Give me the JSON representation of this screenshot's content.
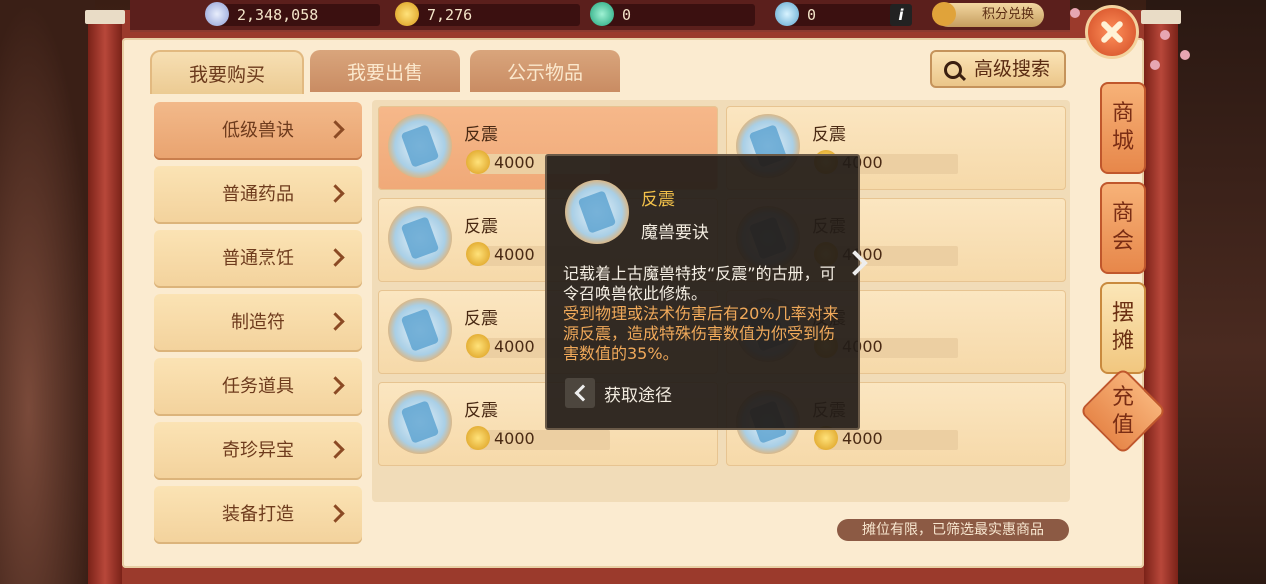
{
  "currencies": [
    {
      "icon": "silver-coin-icon",
      "value": "2,348,058"
    },
    {
      "icon": "gold-coin-icon",
      "value": "7,276"
    },
    {
      "icon": "jade-icon",
      "value": "0"
    },
    {
      "icon": "gem-icon",
      "value": "0"
    }
  ],
  "info_label": "i",
  "exchange_label": "积分兑换",
  "tabs": [
    {
      "label": "我要购买",
      "active": true
    },
    {
      "label": "我要出售",
      "active": false
    },
    {
      "label": "公示物品",
      "active": false
    }
  ],
  "search_label": "高级搜索",
  "categories": [
    {
      "label": "低级兽诀",
      "active": true
    },
    {
      "label": "普通药品",
      "active": false
    },
    {
      "label": "普通烹饪",
      "active": false
    },
    {
      "label": "制造符",
      "active": false
    },
    {
      "label": "任务道具",
      "active": false
    },
    {
      "label": "奇珍异宝",
      "active": false
    },
    {
      "label": "装备打造",
      "active": false
    }
  ],
  "items": [
    {
      "name": "反震",
      "price": "4000"
    },
    {
      "name": "反震",
      "price": "4000"
    },
    {
      "name": "反震",
      "price": "4000"
    },
    {
      "name": "反震",
      "price": "4000"
    },
    {
      "name": "反震",
      "price": "4000"
    },
    {
      "name": "反震",
      "price": "4000"
    },
    {
      "name": "反震",
      "price": "4000"
    },
    {
      "name": "反震",
      "price": "4000"
    }
  ],
  "notice": "摊位有限，已筛选最实惠商品",
  "side_buttons": [
    {
      "label_lines": [
        "商",
        "城"
      ]
    },
    {
      "label_lines": [
        "商",
        "会"
      ]
    },
    {
      "label_lines": [
        "摆",
        "摊"
      ]
    }
  ],
  "recharge_lines": [
    "充",
    "值"
  ],
  "tooltip": {
    "name": "反震",
    "type": "魔兽要诀",
    "description": "记载着上古魔兽特技“反震”的古册，可令召唤兽依此修炼。",
    "effect": "受到物理或法术伤害后有20%几率对来源反震，造成特殊伤害数值为你受到伤害数值的35%。",
    "source_label": "获取途径"
  }
}
